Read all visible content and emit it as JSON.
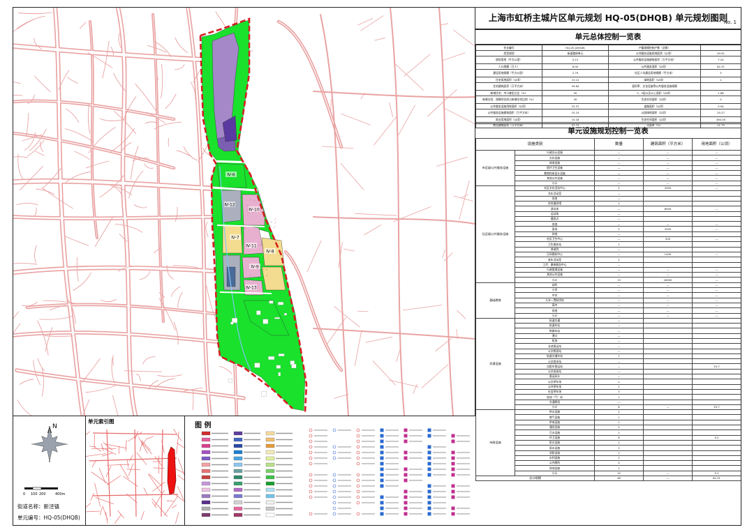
{
  "document": {
    "title": "上海市虹桥主城片区单元规划 HQ-05(DHQB) 单元规划图则",
    "sheet_no": "No. 1"
  },
  "map": {
    "parcel_labels": [
      "Ⅳ-6",
      "Ⅳ-7",
      "Ⅳ-8",
      "Ⅳ-9",
      "Ⅳ-10",
      "Ⅳ-11",
      "Ⅳ-12",
      "Ⅳ-13"
    ],
    "colors": {
      "road": "#e9a3a3",
      "greenspace": "#19e12c",
      "boundary": "#d41f1f",
      "residential": "#a488c8",
      "water": "#7ec6f2",
      "commercial": "#f3dc8f",
      "public": "#e8b0cf",
      "gray_block": "#aab0bd"
    }
  },
  "bottom": {
    "compass_letter": "N",
    "scale_labels": [
      "0",
      "100",
      "200",
      "400m"
    ],
    "street_label": "街道名称：新泾镇",
    "unit_label": "单元编号：HQ-05(DHQB)",
    "index_title": "单元索引图",
    "legend_title": "图 例"
  },
  "control_section": {
    "title": "单元总体控制一览表",
    "rows": [
      [
        "作业编号",
        "HQ-05-(DHQB)",
        "户籍规模控制户数（总数）",
        ""
      ],
      [
        "类型规划",
        "街道整体单元",
        "公共服务设施用地面积（公顷）",
        "49.91"
      ],
      [
        "规划用地（平方公里）",
        "5.13",
        "公共服务设施建筑面积（万平方米）",
        "7.24"
      ],
      [
        "人口规模（万人）",
        "6.00",
        "公共服务面积（公顷）",
        "82.31"
      ],
      [
        "建设用地规模（平方公里）",
        "2.79",
        "社区人均建设用地规模（平方米）",
        "3"
      ],
      [
        "住宅用地面积（公顷）",
        "13.12",
        "绿地面积（公顷）",
        "1"
      ],
      [
        "住宅建筑面积（万平方米）",
        "29.64",
        "容积率、文化设施等公共服务设施规模",
        ""
      ],
      [
        "新增住宅、中小套型占比（%）",
        "50",
        "3、5层以及以上面积（公顷）",
        "1.88"
      ],
      [
        "新增住宅、保障性住房占新增住宅比例（%）",
        "30",
        "生态空间面积（公顷）",
        "0"
      ],
      [
        "公共服务设施用地面积（公顷）",
        "23.37",
        "道路面积（公顷）",
        "5.94"
      ],
      [
        "公共服务设施建筑面积（万平方米）",
        "15.15",
        "公园绿地面积（公顷）",
        "20.27"
      ],
      [
        "商业用地面积（公顷）",
        "10.18",
        "生态空间面积（公顷）",
        "490.00"
      ],
      [
        "商业建筑面积（万平方米）",
        "37.73",
        "河面率（%）",
        "11.75"
      ]
    ]
  },
  "facility_section": {
    "title": "单元设施规划控制一览表",
    "headers": [
      "设施类别",
      "数量",
      "建筑面积（平方米）",
      "用地面积（公顷）"
    ],
    "rows": [
      [
        "市区级公共服务设施",
        "行政办公设施",
        "—",
        "—",
        "—"
      ],
      [
        "",
        "文化设施",
        "—",
        "—",
        "—"
      ],
      [
        "",
        "体育设施",
        "—",
        "—",
        "—"
      ],
      [
        "",
        "医疗卫生设施",
        "—",
        "—",
        "—"
      ],
      [
        "",
        "教育科研设计设施",
        "—",
        "—",
        "—"
      ],
      [
        "",
        "其他公共设施",
        "—",
        "—",
        "—"
      ],
      [
        "",
        "小计",
        "—",
        "—",
        "—"
      ],
      [
        "社区级公共服务设施",
        "社区文化活动中心",
        "2",
        "3200",
        "—"
      ],
      [
        "",
        "文化活动室",
        "—",
        "",
        ""
      ],
      [
        "",
        "其他",
        "—",
        "",
        ""
      ],
      [
        "",
        "综合健身馆",
        "1",
        "",
        ""
      ],
      [
        "",
        "游泳池",
        "—",
        "8000",
        "—"
      ],
      [
        "",
        "运动场",
        "—",
        "",
        ""
      ],
      [
        "",
        "健身点",
        "—",
        "",
        ""
      ],
      [
        "",
        "其他",
        "—",
        "—",
        "—"
      ],
      [
        "",
        "菜场",
        "2",
        "3200",
        "—"
      ],
      [
        "",
        "其他",
        "—",
        "",
        ""
      ],
      [
        "",
        "社区卫生中心",
        "—",
        "200",
        "—"
      ],
      [
        "",
        "卫生服务站",
        "1",
        "",
        ""
      ],
      [
        "",
        "养老院",
        "—",
        "",
        ""
      ],
      [
        "",
        "日间照料中心",
        "—",
        "1400",
        "—"
      ],
      [
        "",
        "老年活动室",
        "2",
        "",
        ""
      ],
      [
        "",
        "工疗、康体服务中心",
        "—",
        "",
        ""
      ],
      [
        "",
        "行政管理设施",
        "—",
        "—",
        "—"
      ],
      [
        "",
        "其他公共设施",
        "—",
        "—",
        "—"
      ],
      [
        "",
        "小计",
        "13",
        "16000",
        "—"
      ],
      [
        "基础教育",
        "幼托",
        "—",
        "—",
        "—"
      ],
      [
        "",
        "小学",
        "—",
        "—",
        "—"
      ],
      [
        "",
        "中学",
        "—",
        "—",
        "—"
      ],
      [
        "",
        "九年一贯制学校",
        "—",
        "—",
        "—"
      ],
      [
        "",
        "高中",
        "—",
        "—",
        "—"
      ],
      [
        "",
        "其他",
        "—",
        "—",
        "—"
      ],
      [
        "",
        "小计",
        "—",
        "—",
        "—"
      ],
      [
        "交通设施",
        "轨道交通",
        "—",
        "",
        ""
      ],
      [
        "",
        "轨道车站",
        "—",
        "",
        ""
      ],
      [
        "",
        "铁路车站",
        "—",
        "",
        ""
      ],
      [
        "",
        "港口",
        "—",
        "",
        ""
      ],
      [
        "",
        "机场",
        "—",
        "",
        ""
      ],
      [
        "",
        "长途客运站",
        "—",
        "",
        ""
      ],
      [
        "",
        "公交枢纽站",
        "—",
        "",
        ""
      ],
      [
        "",
        "轨道交通车站",
        "1",
        "",
        ""
      ],
      [
        "",
        "公交首末站",
        "—",
        "",
        ""
      ],
      [
        "",
        "出租车营运站",
        "—",
        "",
        "25.7"
      ],
      [
        "",
        "公交加油站",
        "—",
        "",
        ""
      ],
      [
        "",
        "客运码头",
        "—",
        "",
        ""
      ],
      [
        "",
        "公交停车场",
        "1",
        "",
        ""
      ],
      [
        "",
        "公共停车场",
        "1",
        "",
        ""
      ],
      [
        "",
        "社会停车场",
        "3",
        "",
        ""
      ],
      [
        "",
        "加油（气）站",
        "1",
        "",
        ""
      ],
      [
        "",
        "交通枢纽",
        "—",
        "",
        ""
      ],
      [
        "",
        "小计",
        "6",
        "—",
        "25.7"
      ],
      [
        "市政设施",
        "供水设施",
        "2",
        "",
        ""
      ],
      [
        "",
        "燃气设施",
        "1",
        "",
        ""
      ],
      [
        "",
        "供电设施",
        "1",
        "",
        ""
      ],
      [
        "",
        "通信设施",
        "2",
        "",
        ""
      ],
      [
        "",
        "污水设施",
        "1",
        "",
        ""
      ],
      [
        "",
        "环卫设施",
        "6",
        "",
        "9.2"
      ],
      [
        "",
        "防灾设施",
        "1",
        "",
        ""
      ],
      [
        "",
        "雨水设施",
        "3",
        "",
        ""
      ],
      [
        "",
        "消防设施",
        "1",
        "",
        ""
      ],
      [
        "",
        "水利设施",
        "2",
        "",
        ""
      ],
      [
        "",
        "公共厕所",
        "4",
        "",
        ""
      ],
      [
        "",
        "其他设施",
        "1",
        "",
        ""
      ],
      [
        "",
        "小计",
        "10",
        "—",
        "9.2"
      ],
      [
        "总计规模",
        "",
        "46",
        "—",
        "82.31"
      ]
    ]
  }
}
